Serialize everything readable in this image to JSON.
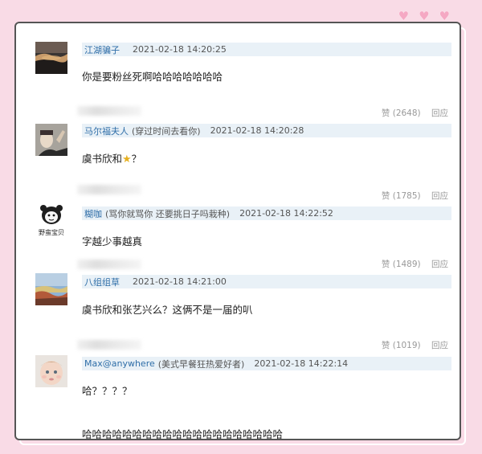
{
  "decor": {
    "hearts": [
      "♥",
      "♥",
      "♥"
    ],
    "accent_color": "#f9dbe6"
  },
  "comments": [
    {
      "username": "江湖骗子",
      "tagline": "",
      "time": "2021-02-18 14:20:25",
      "text": "你是要粉丝死啊哈哈哈哈哈哈哈",
      "likes": "赞 (2648)",
      "reply": "回应"
    },
    {
      "username": "马尔福夫人",
      "tagline": "(穿过时间去看你)",
      "time": "2021-02-18 14:20:28",
      "text_before": "虞书欣和",
      "text_after": "？",
      "likes": "赞 (1785)",
      "reply": "回应"
    },
    {
      "username": "糊咖",
      "tagline": "(骂你就骂你 还要挑日子吗栽种)",
      "time": "2021-02-18 14:22:52",
      "text": "字越少事越真",
      "avatar_label": "野蛮宝贝",
      "likes": "赞 (1489)",
      "reply": "回应"
    },
    {
      "username": "八组组草",
      "tagline": "",
      "time": "2021-02-18 14:21:00",
      "text": "虞书欣和张艺兴么？这俩不是一届的叭",
      "likes": "赞 (1019)",
      "reply": "回应"
    },
    {
      "username": "Max@anywhere",
      "tagline": "(美式早餐狂热爱好者)",
      "time": "2021-02-18 14:22:14",
      "text": "哈？？？？",
      "text2": "哈哈哈哈哈哈哈哈哈哈哈哈哈哈哈哈哈哈哈哈"
    }
  ]
}
